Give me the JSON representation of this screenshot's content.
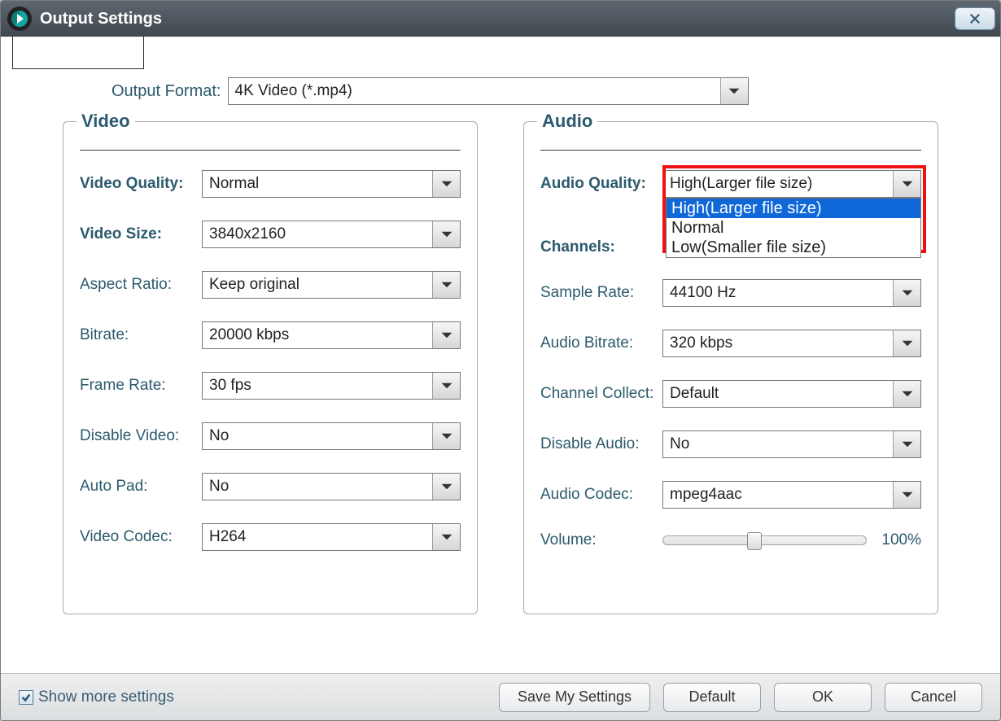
{
  "titlebar": {
    "title": "Output Settings"
  },
  "format": {
    "label": "Output Format:",
    "value": "4K Video (*.mp4)"
  },
  "video": {
    "legend": "Video",
    "quality": {
      "label": "Video Quality:",
      "value": "Normal"
    },
    "size": {
      "label": "Video Size:",
      "value": "3840x2160"
    },
    "aspect": {
      "label": "Aspect Ratio:",
      "value": "Keep original"
    },
    "bitrate": {
      "label": "Bitrate:",
      "value": "20000 kbps"
    },
    "framerate": {
      "label": "Frame Rate:",
      "value": "30 fps"
    },
    "disable": {
      "label": "Disable Video:",
      "value": "No"
    },
    "autopad": {
      "label": "Auto Pad:",
      "value": "No"
    },
    "codec": {
      "label": "Video Codec:",
      "value": "H264"
    }
  },
  "audio": {
    "legend": "Audio",
    "quality": {
      "label": "Audio Quality:",
      "value": "High(Larger file size)",
      "options": [
        "High(Larger file size)",
        "Normal",
        "Low(Smaller file size)"
      ]
    },
    "channels": {
      "label": "Channels:"
    },
    "samplerate": {
      "label": "Sample Rate:",
      "value": "44100 Hz"
    },
    "bitrate": {
      "label": "Audio Bitrate:",
      "value": "320 kbps"
    },
    "channelcollect": {
      "label": "Channel Collect:",
      "value": "Default"
    },
    "disable": {
      "label": "Disable Audio:",
      "value": "No"
    },
    "codec": {
      "label": "Audio Codec:",
      "value": "mpeg4aac"
    },
    "volume": {
      "label": "Volume:",
      "percent_text": "100%"
    }
  },
  "footer": {
    "showmore": "Show more settings",
    "save": "Save My Settings",
    "default": "Default",
    "ok": "OK",
    "cancel": "Cancel"
  }
}
